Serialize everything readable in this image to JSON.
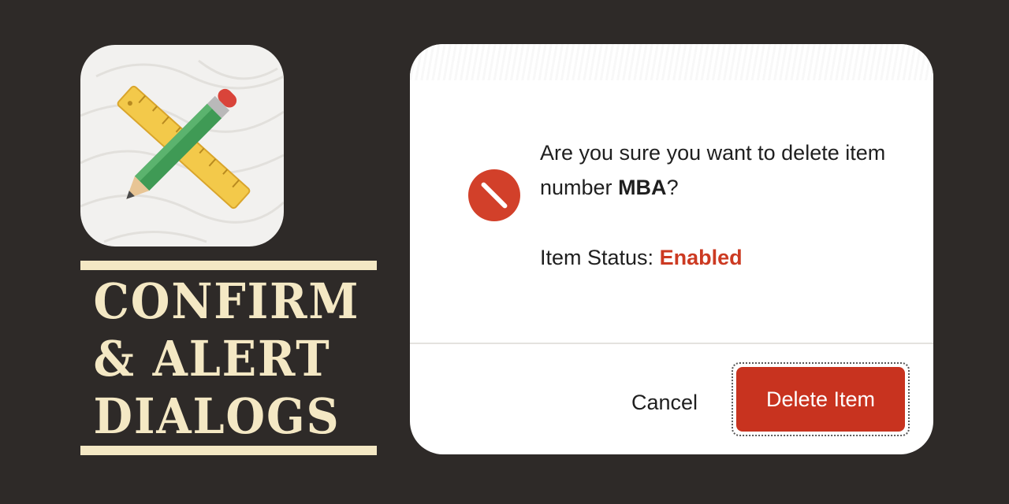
{
  "app_icon": {
    "name": "pencil-and-ruler-icon",
    "tile_color": "#f2f1ef"
  },
  "title": {
    "lines": [
      "CONFIRM",
      "& ALERT",
      "DIALOGS"
    ],
    "color": "#f4e8c4"
  },
  "dialog": {
    "icon": "blocked-icon",
    "question_prefix": "Are you sure you want to delete item number ",
    "item_number": "MBA",
    "question_suffix": "?",
    "status_label": "Item Status: ",
    "status_value": "Enabled",
    "buttons": {
      "cancel": "Cancel",
      "delete": "Delete Item"
    },
    "colors": {
      "danger": "#c8331f",
      "status_enabled": "#cc3a22"
    }
  }
}
